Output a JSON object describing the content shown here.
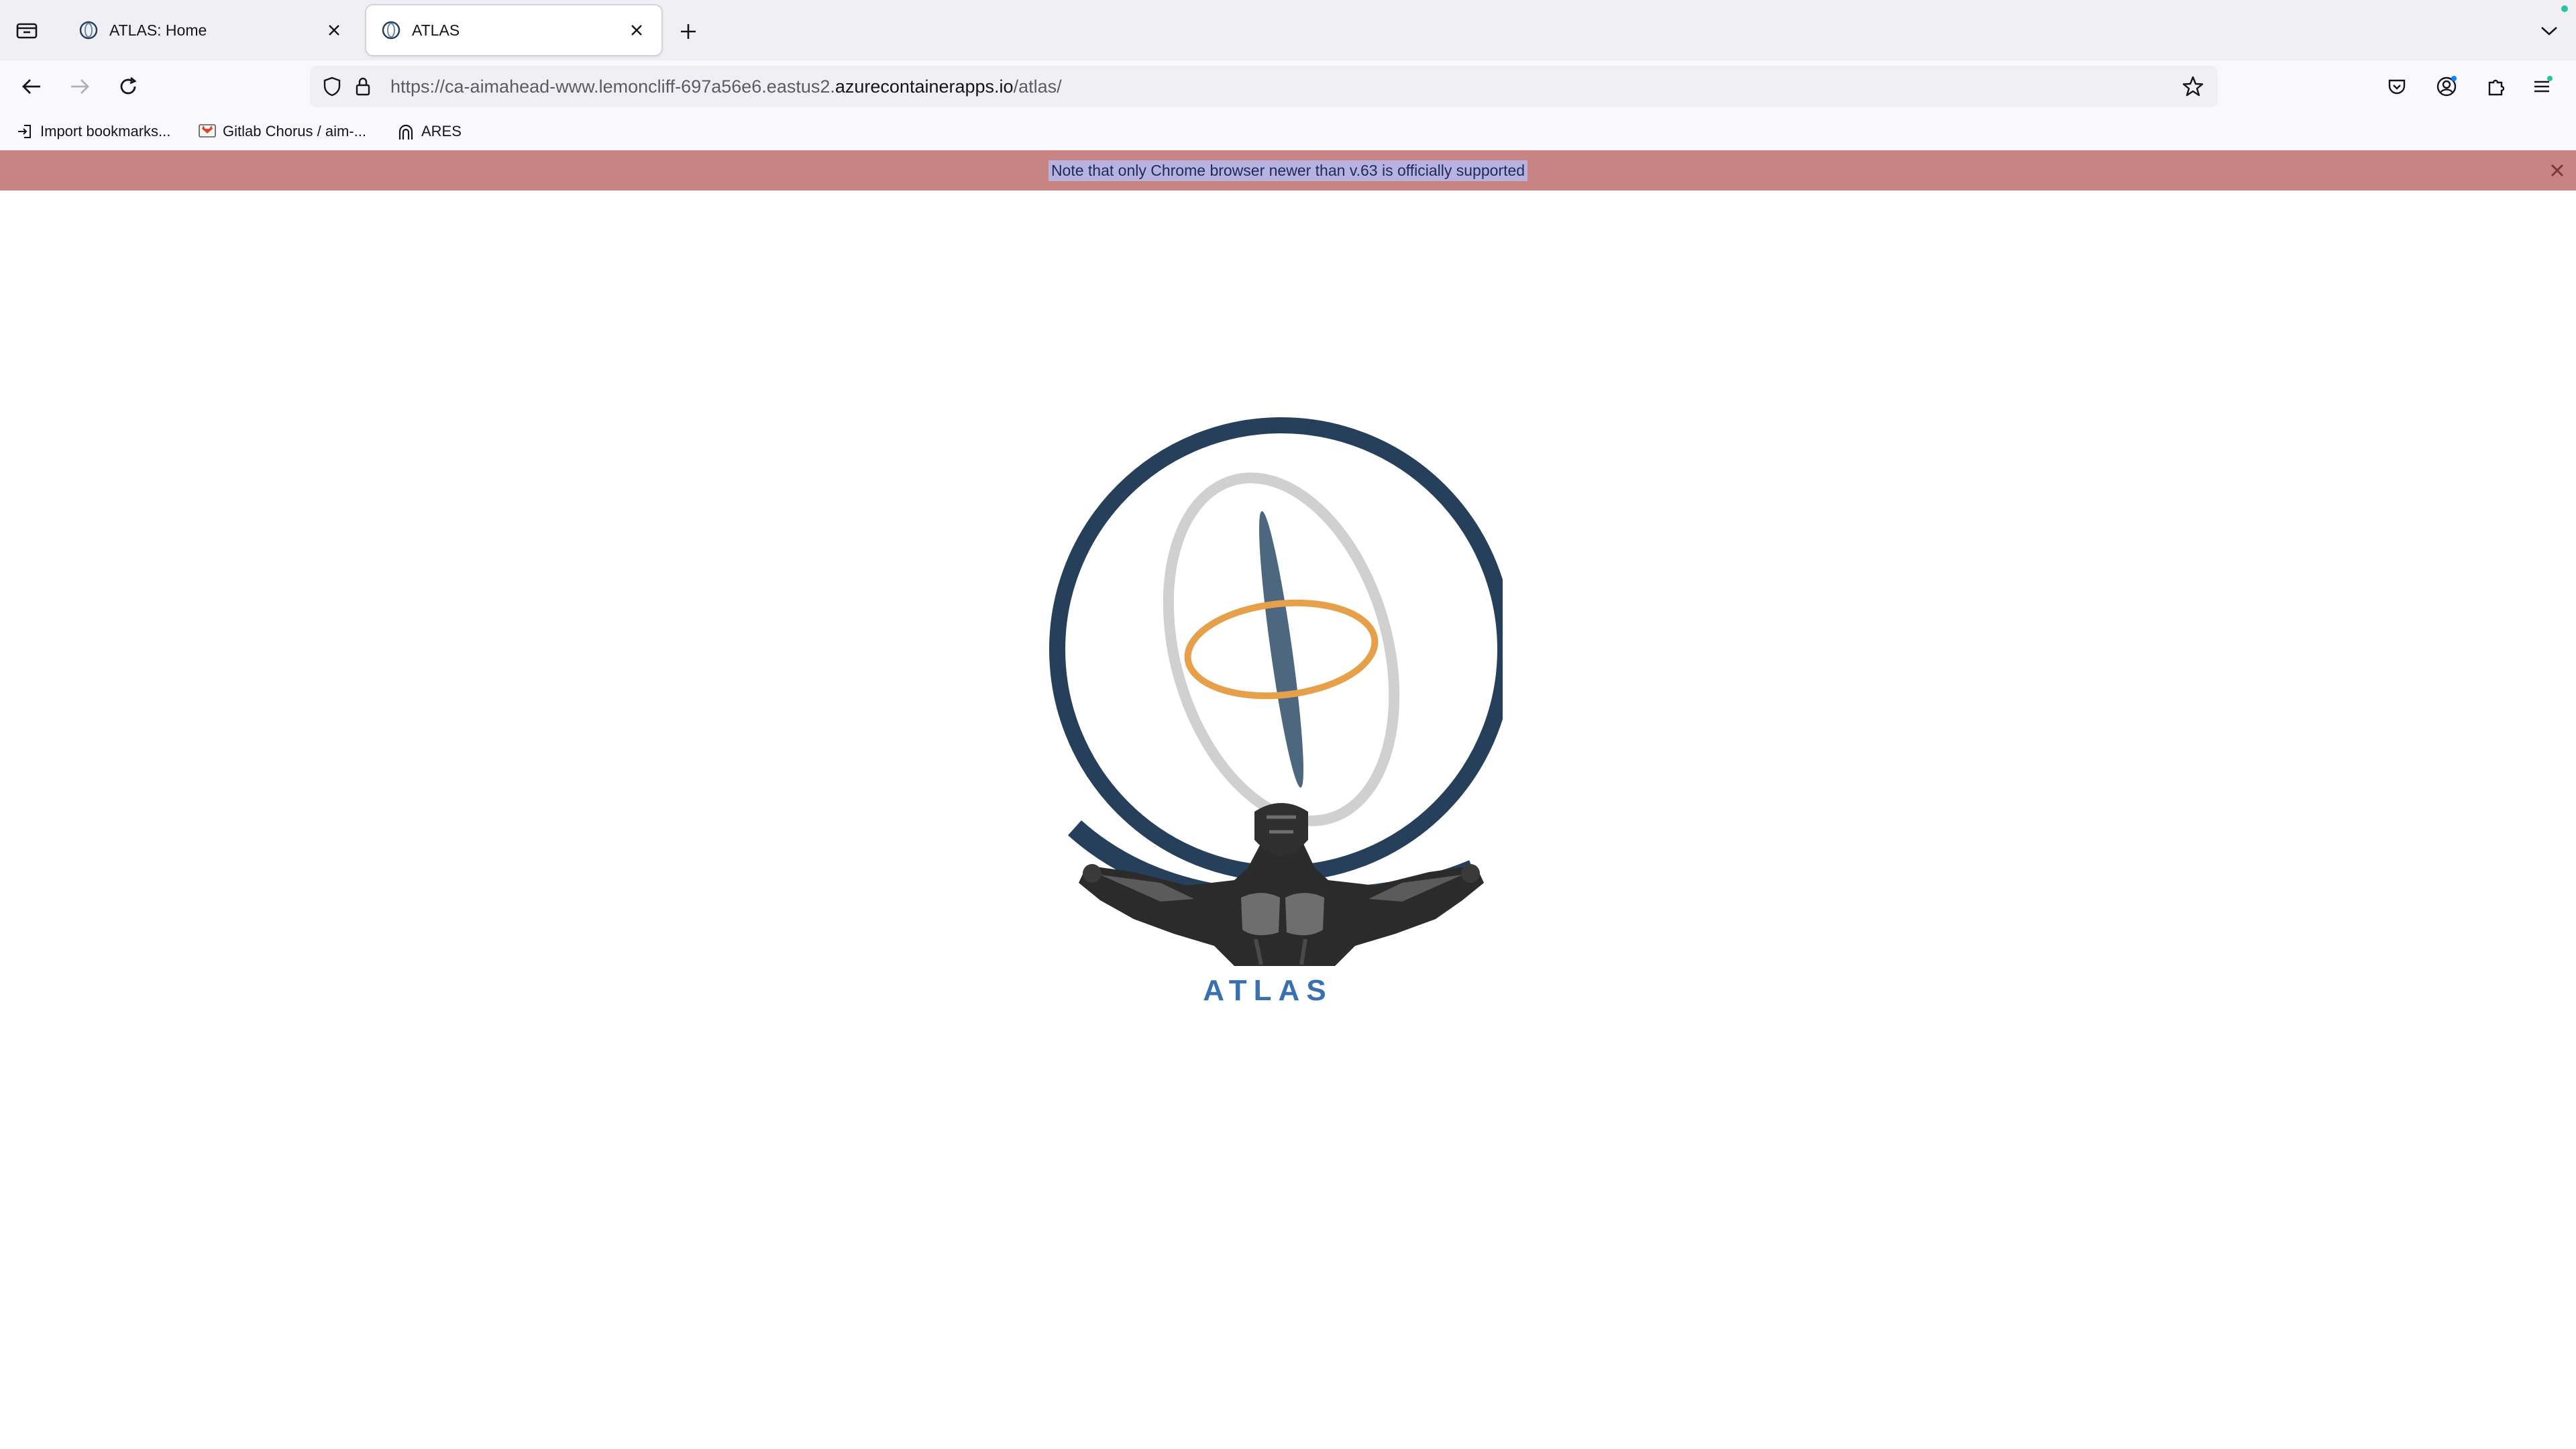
{
  "browser": {
    "tabs": [
      {
        "title": "ATLAS: Home",
        "active": false
      },
      {
        "title": "ATLAS",
        "active": true
      }
    ],
    "url": {
      "prefix": "https://ca-aimahead-www.lemoncliff-697a56e6.eastus2.",
      "host": "azurecontainerapps.io",
      "path": "/atlas/"
    },
    "bookmarks": [
      {
        "label": "Import bookmarks...",
        "icon": "import-icon"
      },
      {
        "label": "Gitlab Chorus / aim-...",
        "icon": "gitlab-icon"
      },
      {
        "label": "ARES",
        "icon": "ares-icon"
      }
    ]
  },
  "notice": {
    "text": "Note that only Chrome browser newer than v.63 is officially supported"
  },
  "logo": {
    "text": "ATLAS"
  },
  "colors": {
    "globe_ring": "#26405c",
    "orbit_gray": "#d0d0d0",
    "orbit_orange": "#e6a04a",
    "orbit_blue": "#4d6781",
    "logo_text": "#3a6fb0",
    "banner": "#c78483"
  }
}
